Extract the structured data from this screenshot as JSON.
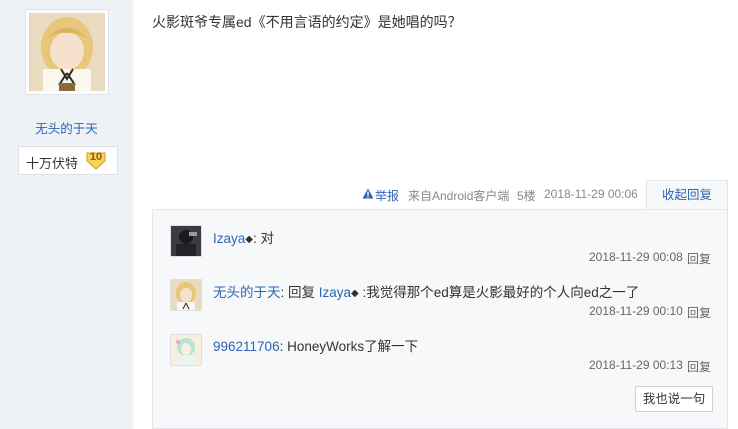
{
  "author": {
    "name": "无头的于天",
    "level_title": "十万伏特",
    "level_number": "10"
  },
  "post": {
    "content": "火影斑爷专属ed《不用言语的约定》是她唱的吗？",
    "report_label": "举报",
    "source": "来自Android客户端",
    "floor": "5楼",
    "time": "2018-11-29 00:06",
    "collapse_label": "收起回复"
  },
  "replies": [
    {
      "user": "Izaya",
      "reply_to": "",
      "text": ": 对",
      "time": "2018-11-29 00:08",
      "reply_label": "回复"
    },
    {
      "user": "无头的于天",
      "prefix": ": 回复 ",
      "reply_to": "Izaya",
      "text": " :我觉得那个ed算是火影最好的个人向ed之一了",
      "time": "2018-11-29 00:10",
      "reply_label": "回复"
    },
    {
      "user": "996211706",
      "reply_to": "",
      "text": ": HoneyWorks了解一下",
      "time": "2018-11-29 00:13",
      "reply_label": "回复"
    }
  ],
  "say_button_label": "我也说一句",
  "colors": {
    "link": "#2d64b3",
    "sidebar_bg": "#eef1f6",
    "panel_bg": "#f7f8fa"
  }
}
